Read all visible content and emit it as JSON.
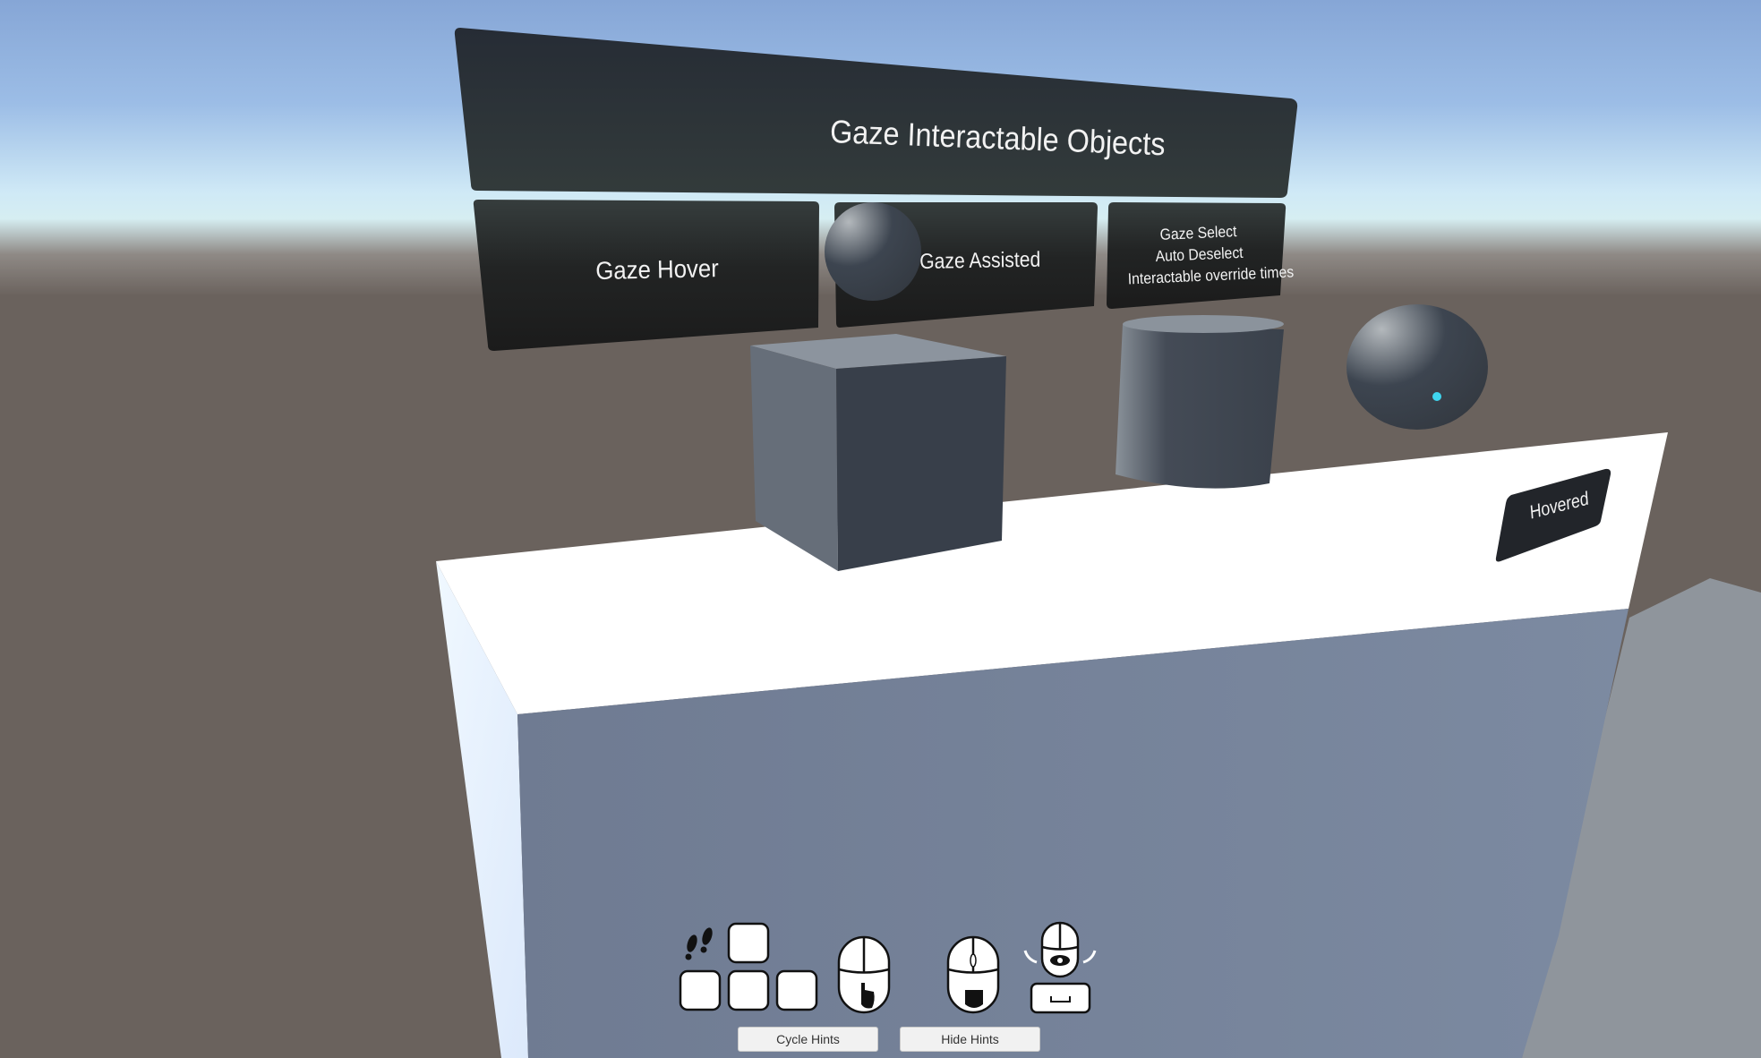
{
  "scene": {
    "title_panel": {
      "label": "Gaze Interactable Objects"
    },
    "panels": [
      {
        "label": "Gaze Hover"
      },
      {
        "label": "Gaze Assisted"
      },
      {
        "lines": [
          "Gaze Select",
          "Auto Deselect",
          "Interactable override times"
        ]
      }
    ],
    "hovered_label": "Hovered",
    "objects": [
      "cube",
      "cylinder",
      "sphere",
      "small-sphere"
    ],
    "gaze_reticle_color": "#3fd6f0",
    "colors": {
      "panel": "#252b31",
      "table_top": "#ffffff",
      "table_front": "#76829a",
      "object": "#3a414b"
    }
  },
  "hints": {
    "icons": [
      "footsteps-icon",
      "wasd-keys",
      "mouse-left-click-icon",
      "mouse-right-grab-icon",
      "mouse-rotate-view-icon",
      "spacebar-key"
    ],
    "cycle_label": "Cycle Hints",
    "hide_label": "Hide Hints"
  }
}
